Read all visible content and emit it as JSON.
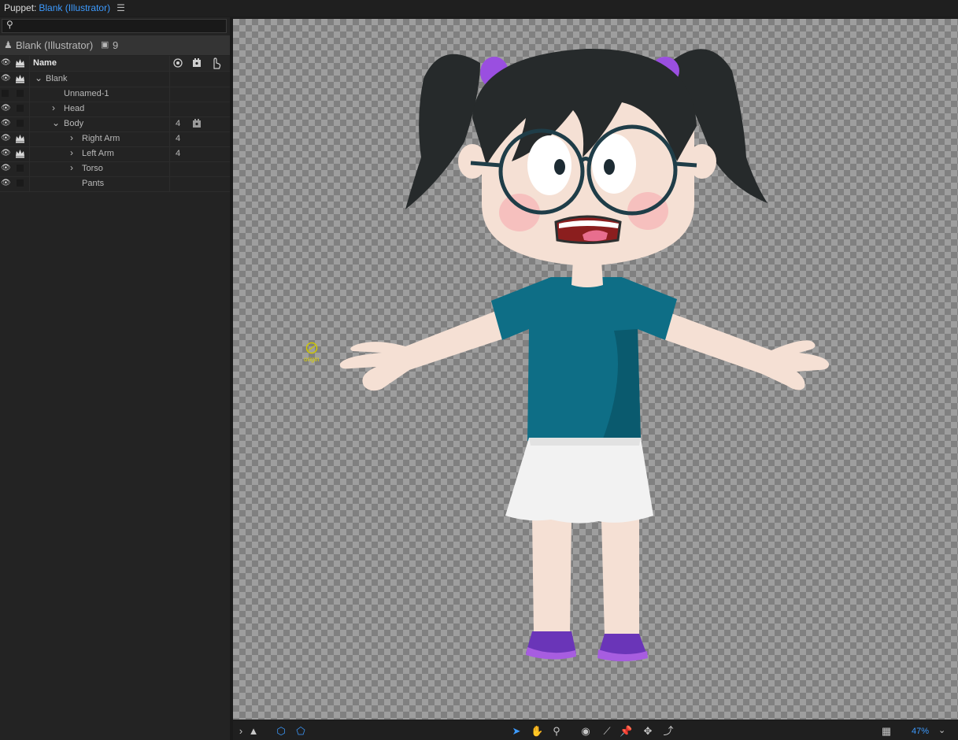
{
  "title": {
    "prefix": "Puppet:",
    "name": "Blank (Illustrator)",
    "menu_icon": "hamburger-menu-icon"
  },
  "search": {
    "icon": "search-icon",
    "value": ""
  },
  "puppet_header": {
    "name": "Blank (Illustrator)",
    "badge_icon": "behaviors-icon",
    "count": "9"
  },
  "columns": {
    "name": "Name"
  },
  "layers": [
    {
      "name": "Blank",
      "indent": 0,
      "count": ""
    },
    {
      "name": "Unnamed-1",
      "indent": 1,
      "count": ""
    },
    {
      "name": "Head",
      "indent": 1,
      "count": ""
    },
    {
      "name": "Body",
      "indent": 1,
      "count": "4"
    },
    {
      "name": "Right Arm",
      "indent": 2,
      "count": "4"
    },
    {
      "name": "Left Arm",
      "indent": 2,
      "count": "4"
    },
    {
      "name": "Torso",
      "indent": 2,
      "count": ""
    },
    {
      "name": "Pants",
      "indent": 2,
      "count": ""
    }
  ],
  "canvas": {
    "origin_label": "origin"
  },
  "toolbar": {
    "zoom": "47%"
  },
  "colors": {
    "accent": "#3d9bff",
    "shirt": "#0e6e86",
    "hair": "#262a2b",
    "skin": "#f5e0d4",
    "shoes": "#7a3cc6"
  }
}
